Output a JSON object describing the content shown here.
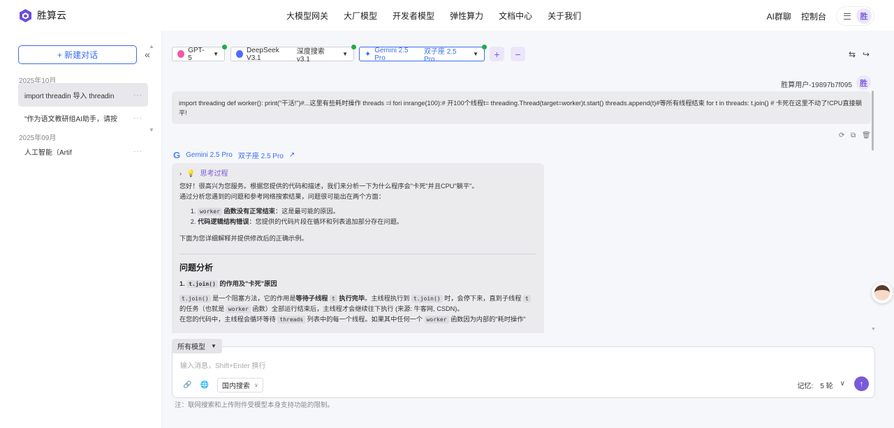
{
  "brand": {
    "name": "胜算云"
  },
  "nav": [
    "大模型网关",
    "大厂模型",
    "开发者模型",
    "弹性算力",
    "文档中心",
    "关于我们"
  ],
  "header_right": {
    "group_chat": "AI群聊",
    "console": "控制台",
    "avatar_text": "胜"
  },
  "sidebar": {
    "new_chat": "+ 新建对话",
    "collapse": "«",
    "groups": [
      {
        "label": "2025年10月",
        "items": [
          "import threadin  导入 threadin",
          "\"作为语文教研组AI助手，请按"
        ]
      },
      {
        "label": "2025年09月",
        "items": [
          "人工智能（Artif"
        ]
      }
    ],
    "more": "···"
  },
  "models": [
    {
      "name": "GPT-5",
      "sub": "",
      "status_color": "#22aa44"
    },
    {
      "name": "DeepSeek V3.1",
      "sub": "深度搜索 v3.1",
      "status_color": "#22aa44"
    },
    {
      "name": "Gemini 2.5 Pro",
      "sub": "双子座 2.5 Pro",
      "status_color": "#22aa44"
    }
  ],
  "model_add": "+",
  "model_remove": "−",
  "user_message": {
    "user": "胜算用户-19897b7f095",
    "avatar_text": "胜",
    "text": "import threading def worker(): print(\"干活!\")#...这里有些耗时操作 threads =l fori inrange(100):# 开100个线程t= threading.Thread(target=worker)t.start() threads.append(t)#等所有线程结束 for t in threads: t.join() # 卡死在这里不动了!CPU直接躺平!"
  },
  "ai_message": {
    "model": "Gemini 2.5 Pro",
    "model_sub": "双子座 2.5 Pro",
    "thinking": "思考过程",
    "intro1": "您好！很高兴为您服务。根据您提供的代码和描述，我们来分析一下为什么程序会\"卡死\"并且CPU\"躺平\"。",
    "intro2": "通过分析您遇到的问题和参考网络搜索结果，问题很可能出在两个方面：",
    "point1_code": "worker",
    "point1_bold": "函数没有正常结束",
    "point1_rest": "：这是最可能的原因。",
    "point2_bold": "代码逻辑结构错误",
    "point2_rest": "：您提供的代码片段在循环和列表追加部分存在问题。",
    "outro": "下面为您详细解释并提供修改后的正确示例。",
    "section_title": "问题分析",
    "sub1_num": "1.",
    "sub1_code": "t.join()",
    "sub1_text": "的作用及\"卡死\"原因",
    "para_code1": "t.join()",
    "para_t1": "是一个阻塞方法，它的作用是",
    "para_b1": "等待子线程",
    "para_code2": "t",
    "para_b2": "执行完毕",
    "para_t2": "。主线程执行到",
    "para_code3": "t.join()",
    "para_t3": "时，会停下来，直到子线程",
    "para_code4": "t",
    "para_t4": "的任务（也就是",
    "para_code5": "worker",
    "para_t5": "函数）全部运行结束后，主线程才会继续往下执行 (来源: 牛客网, CSDN)。",
    "para2_t1": "在您的代码中，主线程会循环等待",
    "para2_code1": "threads",
    "para2_t2": "列表中的每一个线程。如果其中任何一个",
    "para2_code2": "worker",
    "para2_t3": "函数因为内部的\"耗时操作\""
  },
  "composer": {
    "all_models": "所有模型",
    "placeholder": "输入消息，Shift+Enter 换行",
    "search_mode": "国内搜索",
    "memory_label": "记忆:",
    "memory_value": "5 轮",
    "note": "注：联网搜索和上传附件受模型本身支持功能的限制。"
  },
  "colors": {
    "accent": "#3a6df0",
    "purple": "#7a5ad9",
    "status": "#22aa44"
  }
}
